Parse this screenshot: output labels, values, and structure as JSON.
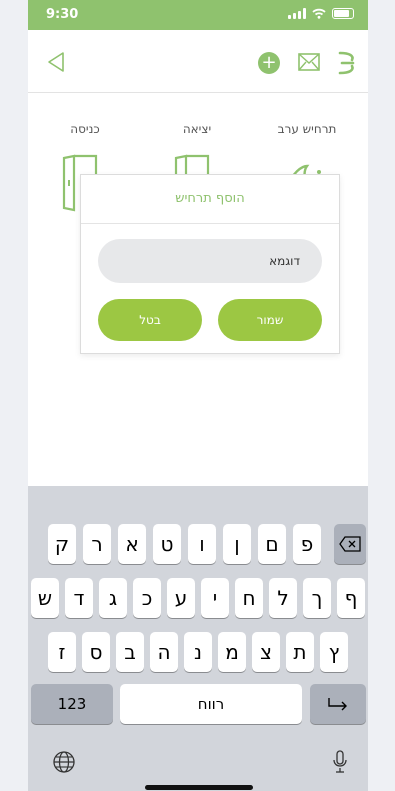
{
  "status_bar": {
    "time": "9:30"
  },
  "colors": {
    "accent": "#8fc26e",
    "button": "#9cc743",
    "keyboard_bg": "#d2d5db"
  },
  "icons": {
    "back": "back-arrow-icon",
    "add": "plus-icon",
    "mail": "mail-icon",
    "menu": "menu-icon"
  },
  "scenarios": [
    {
      "label": "כניסה",
      "icon": "door-enter-icon"
    },
    {
      "label": "יציאה",
      "icon": "door-exit-icon"
    },
    {
      "label": "תרחיש ערב",
      "icon": "moon-stars-icon"
    }
  ],
  "dialog": {
    "title": "הוסף תרחיש",
    "input_value": "דוגמא",
    "cancel_label": "בטל",
    "save_label": "שמור"
  },
  "keyboard": {
    "row1": [
      "ק",
      "ר",
      "א",
      "ט",
      "ו",
      "ן",
      "ם",
      "פ"
    ],
    "row2": [
      "ש",
      "ד",
      "ג",
      "כ",
      "ע",
      "י",
      "ח",
      "ל",
      "ך",
      "ף"
    ],
    "row3": [
      "ז",
      "ס",
      "ב",
      "ה",
      "נ",
      "מ",
      "צ",
      "ת",
      "ץ"
    ],
    "numbers_label": "123",
    "space_label": "רווח"
  }
}
